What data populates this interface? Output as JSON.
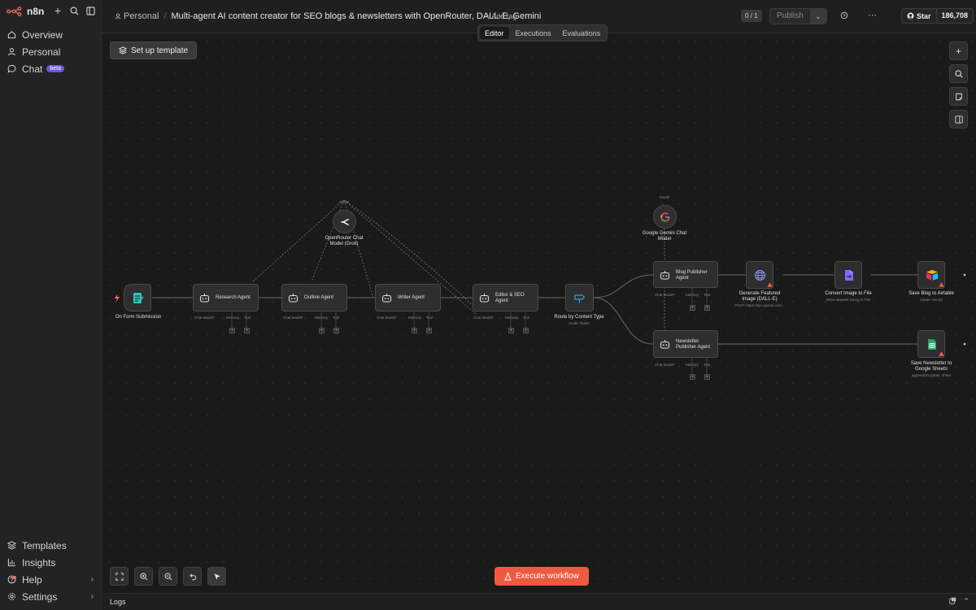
{
  "app": {
    "brand": "n8n"
  },
  "sidebar": {
    "items": [
      {
        "label": "Overview"
      },
      {
        "label": "Personal"
      },
      {
        "label": "Chat",
        "badge": "beta"
      }
    ],
    "bottom_items": [
      {
        "label": "Templates"
      },
      {
        "label": "Insights"
      },
      {
        "label": "Help"
      },
      {
        "label": "Settings"
      }
    ]
  },
  "header": {
    "breadcrumb_project": "Personal",
    "workflow_title": "Multi-agent AI content creator for SEO blogs & newsletters with OpenRouter, DALL-E, Gemini",
    "add_tag": "+ Add tag",
    "tabs": [
      {
        "label": "Editor",
        "active": true
      },
      {
        "label": "Executions",
        "active": false
      },
      {
        "label": "Evaluations",
        "active": false
      }
    ],
    "counter": "0 / 1",
    "publish_label": "Publish",
    "github_star": "Star",
    "github_count": "186,708"
  },
  "canvas": {
    "setup_button": "Set up template",
    "execute_button": "Execute workflow"
  },
  "logs": {
    "label": "Logs"
  },
  "nodes": {
    "form": {
      "caption": "On Form Submission"
    },
    "research": {
      "label": "Research Agent"
    },
    "outline": {
      "label": "Outline Agent"
    },
    "writer": {
      "label": "Writer Agent"
    },
    "editor": {
      "label_1": "Editor & SEO",
      "label_2": "Agent"
    },
    "route": {
      "caption": "Route by Content Type",
      "sub": "mode: Rules"
    },
    "openrouter": {
      "caption_1": "OpenRouter Chat",
      "caption_2": "Model (Grok)",
      "top": "Model"
    },
    "gemini": {
      "caption_1": "Google Gemini Chat",
      "caption_2": "Model",
      "top": "Model"
    },
    "blog": {
      "label_1": "Blog Publisher",
      "label_2": "Agent"
    },
    "newsletter": {
      "label_1": "Newsletter",
      "label_2": "Publisher Agent"
    },
    "dalle": {
      "caption_1": "Generate Featured",
      "caption_2": "Image (DALL-E)",
      "sub": "POST: https://api.openai.com..."
    },
    "convert": {
      "caption": "Convert Image to File",
      "sub": "Move Base64 String to File"
    },
    "airtable": {
      "caption": "Save Blog to Airtable",
      "sub": "create: record"
    },
    "sheets": {
      "caption_1": "Save Newsletter to",
      "caption_2": "Google Sheets",
      "sub": "appendOrUpdate: sheet"
    },
    "ports": {
      "chat": "Chat Model*",
      "memory": "Memory",
      "tool": "Tool"
    }
  },
  "colors": {
    "accent": "#ee5a3f",
    "beta": "#6b5bd6",
    "background": "#1a1a1a"
  }
}
